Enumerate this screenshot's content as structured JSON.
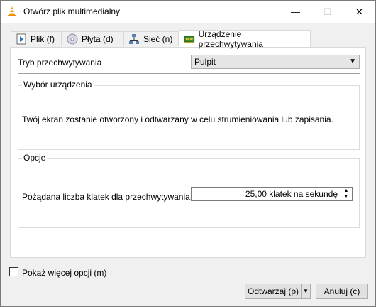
{
  "window": {
    "title": "Otwórz plik multimedialny",
    "controls": {
      "minimize": "—",
      "maximize": "☐",
      "close": "✕"
    }
  },
  "tabs": [
    {
      "label": "Plik (f)",
      "icon": "play-file-icon"
    },
    {
      "label": "Płyta (d)",
      "icon": "disc-icon"
    },
    {
      "label": "Sieć (n)",
      "icon": "network-icon"
    },
    {
      "label": "Urządzenie przechwytywania",
      "icon": "capture-card-icon",
      "active": true
    }
  ],
  "capture": {
    "mode_label": "Tryb przechwytywania",
    "mode_value": "Pulpit"
  },
  "device_group": {
    "title": "Wybór urządzenia",
    "description": "Twój ekran zostanie otworzony i odtwarzany w celu strumieniowania lub zapisania."
  },
  "options_group": {
    "title": "Opcje",
    "fps_label": "Pożądana liczba klatek dla przechwytywania.",
    "fps_value": "25,00 klatek na sekundę"
  },
  "more_options": {
    "label": "Pokaż więcej opcji (m)",
    "checked": false
  },
  "buttons": {
    "play": "Odtwarzaj (p)",
    "cancel": "Anuluj (c)"
  },
  "colors": {
    "vlc_orange": "#f08c00"
  }
}
